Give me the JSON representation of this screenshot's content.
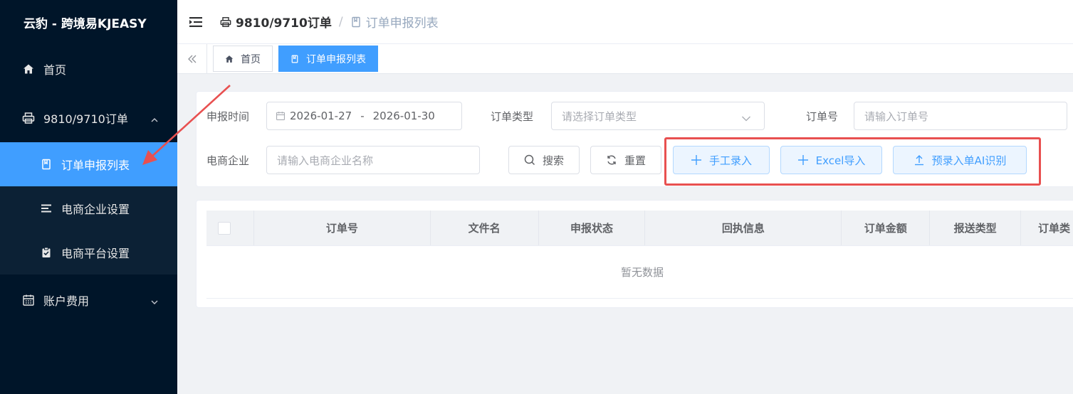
{
  "sidebar": {
    "logo": "云豹 - 跨境易KJEASY",
    "items": [
      {
        "label": "首页",
        "icon": "home-icon"
      },
      {
        "label": "9810/9710订单",
        "icon": "printer-icon"
      },
      {
        "label": "账户费用",
        "icon": "calendar-icon"
      }
    ],
    "submenu": [
      {
        "label": "订单申报列表",
        "icon": "book-icon",
        "active": true
      },
      {
        "label": "电商企业设置",
        "icon": "list-icon"
      },
      {
        "label": "电商平台设置",
        "icon": "clipboard-check-icon"
      }
    ]
  },
  "header": {
    "breadcrumb_first": "9810/9710订单",
    "breadcrumb_sep": "/",
    "breadcrumb_last": "订单申报列表"
  },
  "tabs": [
    {
      "label": "首页",
      "icon": "home-icon",
      "active": false
    },
    {
      "label": "订单申报列表",
      "icon": "book-icon",
      "active": true
    }
  ],
  "filters": {
    "declare_time_label": "申报时间",
    "date_start": "2026-01-27",
    "date_dash": "-",
    "date_end": "2026-01-30",
    "order_type_label": "订单类型",
    "order_type_placeholder": "请选择订单类型",
    "order_no_label": "订单号",
    "order_no_placeholder": "请输入订单号",
    "company_label": "电商企业",
    "company_placeholder": "请输入电商企业名称"
  },
  "buttons": {
    "search": "搜索",
    "reset": "重置",
    "manual": "手工录入",
    "excel": "Excel导入",
    "ai": "预录入单AI识别"
  },
  "table": {
    "columns": [
      "订单号",
      "文件名",
      "申报状态",
      "回执信息",
      "订单金额",
      "报送类型",
      "订单类"
    ],
    "empty_text": "暂无数据"
  },
  "colors": {
    "sidebar_bg": "#001529",
    "accent": "#409eff",
    "highlight": "#e85050"
  }
}
